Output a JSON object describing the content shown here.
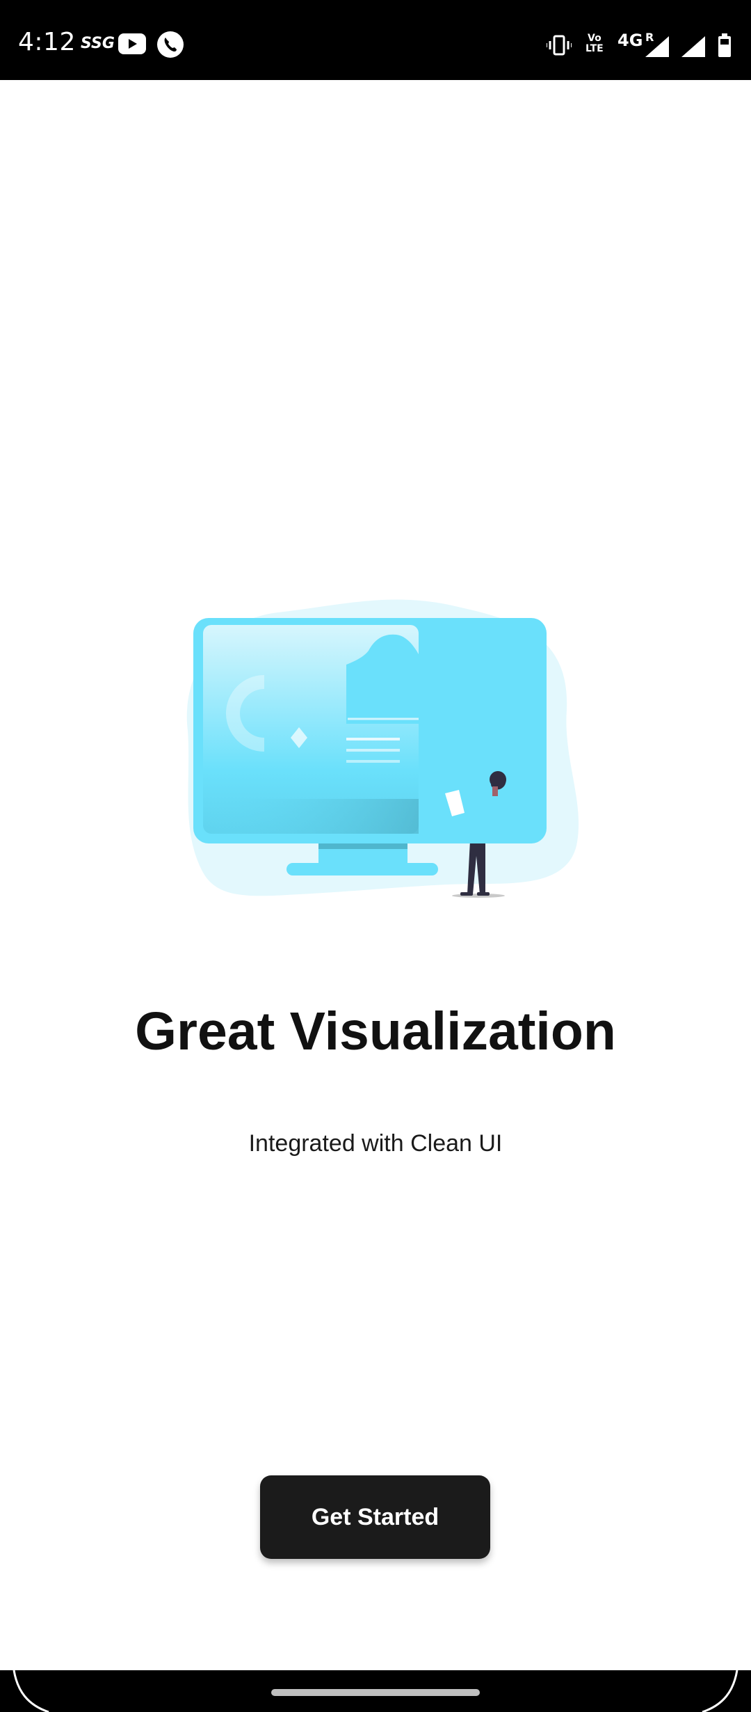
{
  "status_bar": {
    "time": "4:12",
    "carrier_label": "SSG",
    "volte_label_top": "Vo",
    "volte_label_bottom": "LTE",
    "network_label": "4G",
    "roaming_label": "R",
    "icons": [
      "youtube-icon",
      "phone-call-icon",
      "vibrate-icon",
      "volte-icon",
      "signal-icon",
      "signal-icon",
      "battery-icon"
    ]
  },
  "onboarding": {
    "title": "Great Visualization",
    "subtitle": "Integrated with Clean UI",
    "cta_label": "Get Started"
  },
  "colors": {
    "accent": "#6ae0fb",
    "button": "#1b1b1b",
    "blob": "#e3f8fd",
    "figure_dark": "#2f2e41"
  }
}
